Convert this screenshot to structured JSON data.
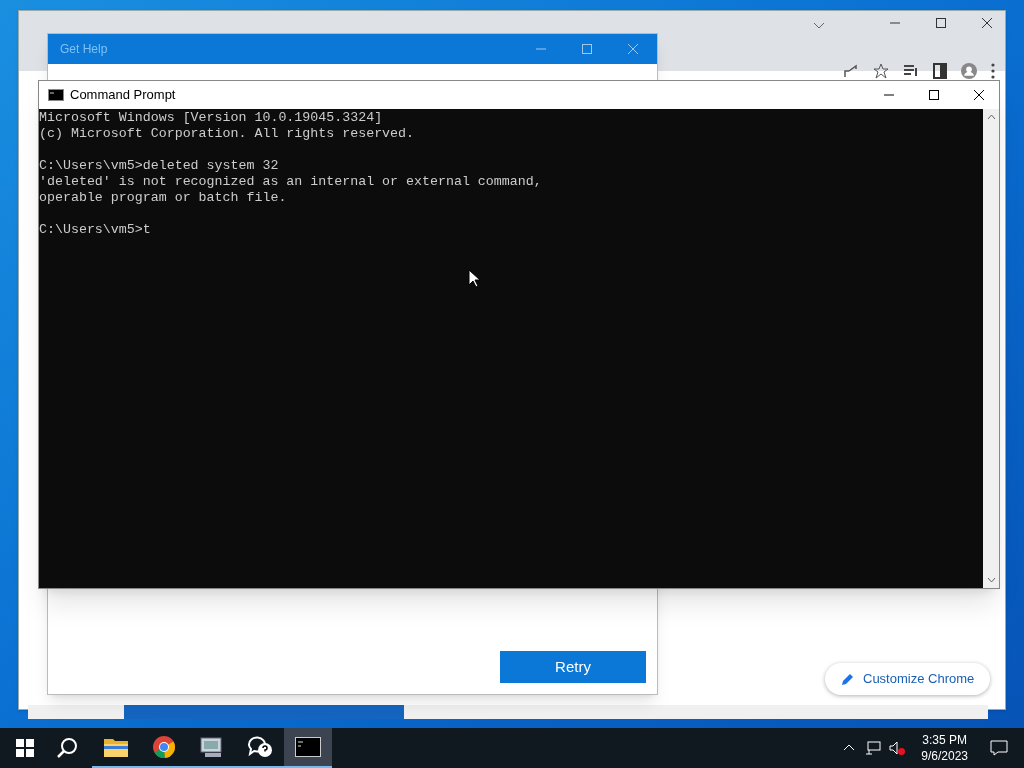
{
  "browser_window": {
    "customize_button": "Customize Chrome"
  },
  "help_window": {
    "title": "Get Help",
    "retry_button": "Retry"
  },
  "console_window": {
    "title": "Command Prompt",
    "blocks": [
      [
        "Microsoft Windows [Version 10.0.19045.3324]",
        "(c) Microsoft Corporation. All rights reserved."
      ],
      [
        "C:\\Users\\vm5>deleted system 32",
        "'deleted' is not recognized as an internal or external command,",
        "operable program or batch file."
      ],
      [
        "C:\\Users\\vm5>t"
      ]
    ]
  },
  "taskbar": {
    "apps": [
      {
        "kind": "folder",
        "selected": false,
        "running": true
      },
      {
        "kind": "chrome",
        "selected": false,
        "running": true
      },
      {
        "kind": "tool",
        "selected": false,
        "running": true
      },
      {
        "kind": "help",
        "selected": false,
        "running": true
      },
      {
        "kind": "console",
        "selected": true,
        "running": true
      }
    ],
    "time": "3:35 PM",
    "date": "9/6/2023"
  }
}
